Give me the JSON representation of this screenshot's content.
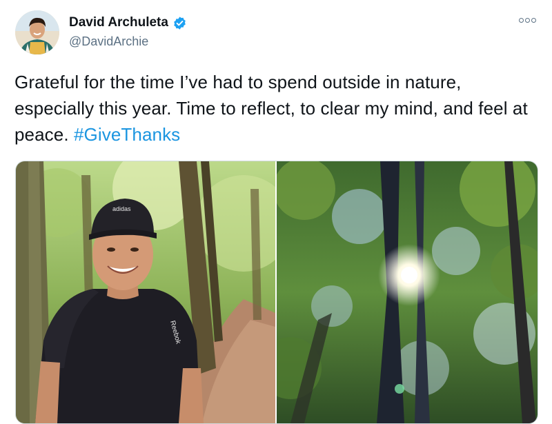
{
  "tweet": {
    "author": {
      "name": "David Archuleta",
      "handle": "@DavidArchie",
      "verified": true
    },
    "text_before": "Grateful for the time I’ve had to spend outside in nature, especially this year. Time to reflect, to clear my mind, and feel at peace. ",
    "hashtag": "#GiveThanks",
    "cap_logo_text": "adidas",
    "shirt_logo_text": "Reebok",
    "icons": [
      "verified-badge-icon",
      "more-options-icon"
    ],
    "colors": {
      "hashtag": "#1b95e0",
      "verified": "#1da1f2",
      "handle": "#5b7083"
    }
  }
}
